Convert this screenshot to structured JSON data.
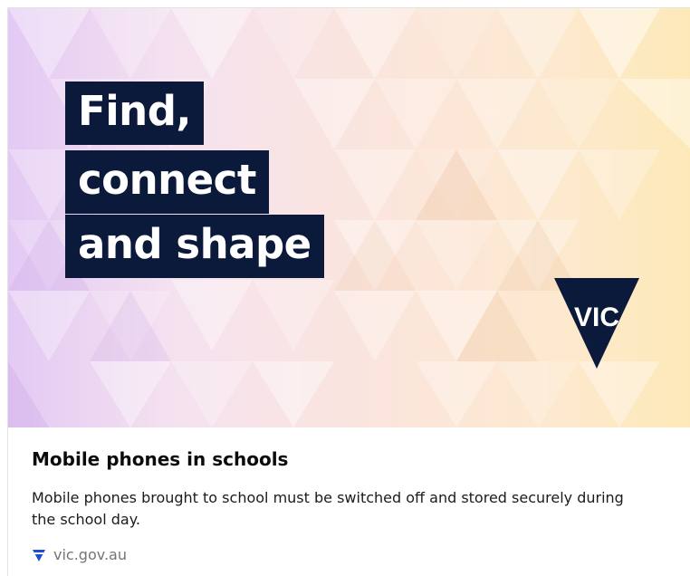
{
  "card": {
    "headline_lines": [
      "Find,",
      "connect",
      "and shape"
    ],
    "logo_text": "VIC",
    "title": "Mobile phones in schools",
    "description": "Mobile phones brought to school must be switched off and stored securely during the school day.",
    "domain": "vic.gov.au"
  },
  "colors": {
    "navy": "#0b1a3a",
    "favicon_blue": "#1c4fd6",
    "domain_grey": "#757575"
  }
}
